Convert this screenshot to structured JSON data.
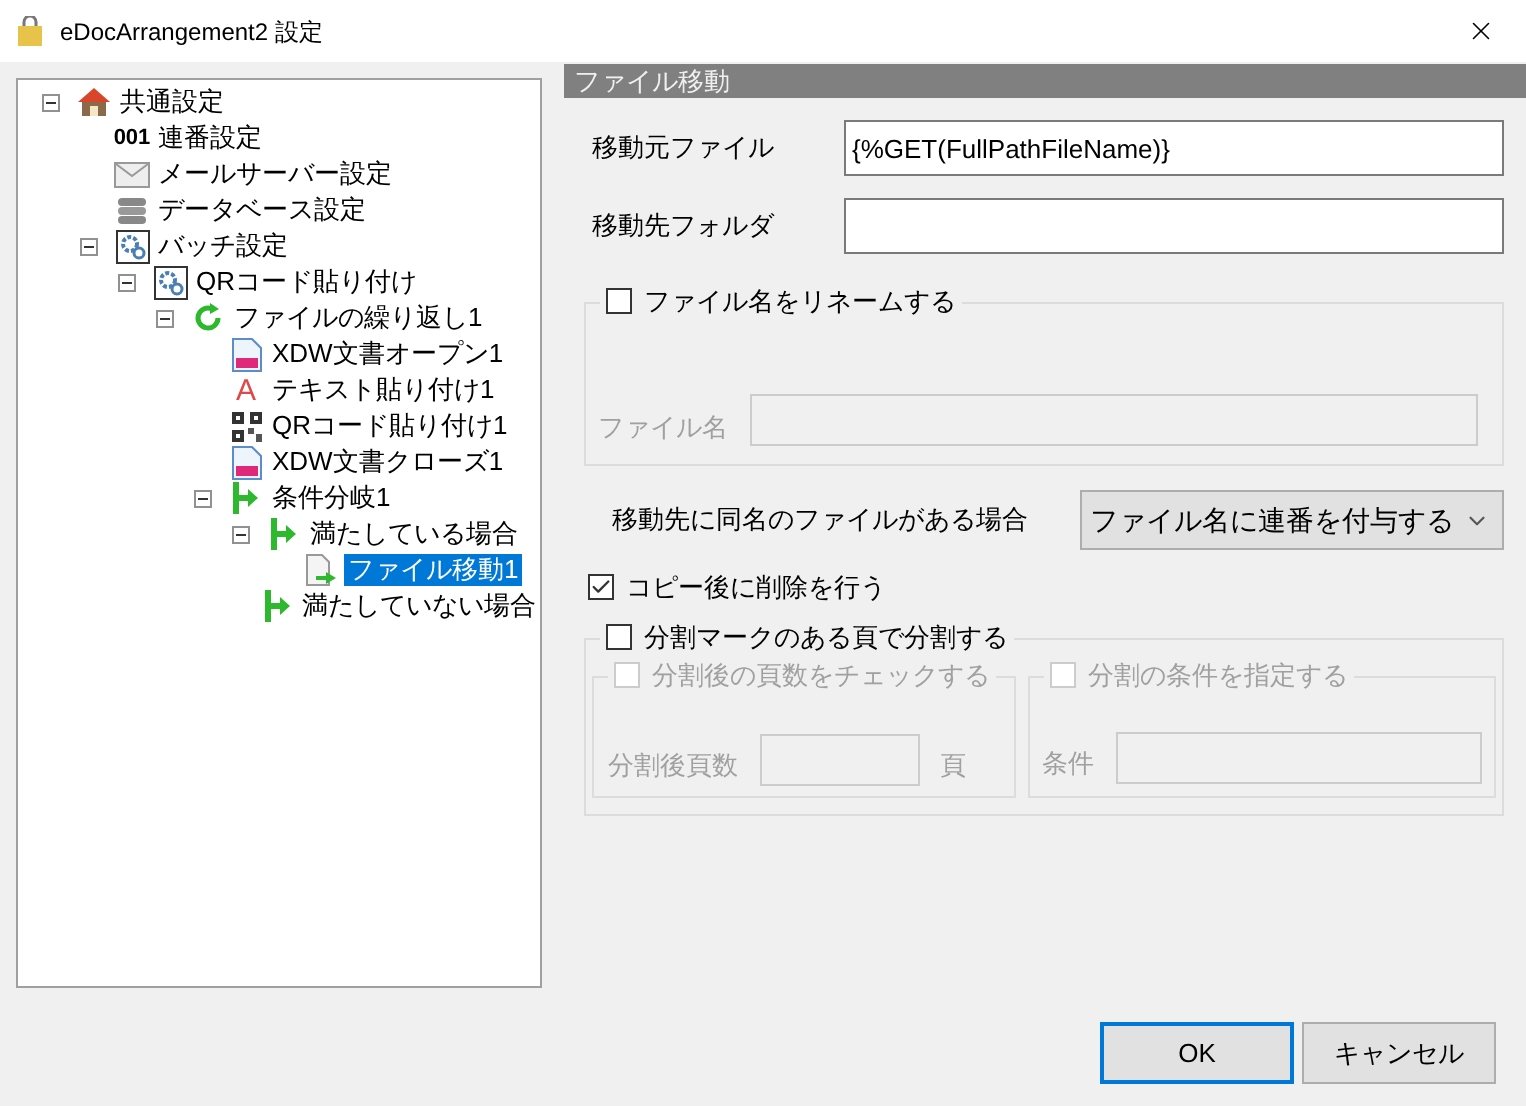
{
  "window": {
    "title": "eDocArrangement2 設定"
  },
  "tree": [
    {
      "label": "共通設定",
      "kind": "house",
      "expanded": true,
      "selected": false,
      "children": [
        {
          "label": "連番設定",
          "kind": "number",
          "badge": "001",
          "selected": false
        },
        {
          "label": "メールサーバー設定",
          "kind": "mail",
          "selected": false
        },
        {
          "label": "データベース設定",
          "kind": "database",
          "selected": false
        },
        {
          "label": "バッチ設定",
          "kind": "gear",
          "expanded": true,
          "selected": false,
          "children": [
            {
              "label": "QRコード貼り付け",
              "kind": "gear",
              "expanded": true,
              "selected": false,
              "children": [
                {
                  "label": "ファイルの繰り返し1",
                  "kind": "loop",
                  "expanded": true,
                  "selected": false,
                  "children": [
                    {
                      "label": "XDW文書オープン1",
                      "kind": "doc",
                      "selected": false
                    },
                    {
                      "label": "テキスト貼り付け1",
                      "kind": "letter",
                      "badge": "A",
                      "selected": false
                    },
                    {
                      "label": "QRコード貼り付け1",
                      "kind": "qr",
                      "selected": false
                    },
                    {
                      "label": "XDW文書クローズ1",
                      "kind": "doc",
                      "selected": false
                    },
                    {
                      "label": "条件分岐1",
                      "kind": "branch",
                      "expanded": true,
                      "selected": false,
                      "children": [
                        {
                          "label": "満たしている場合",
                          "kind": "branch",
                          "expanded": true,
                          "selected": false,
                          "children": [
                            {
                              "label": "ファイル移動1",
                              "kind": "filemove",
                              "selected": true
                            }
                          ]
                        },
                        {
                          "label": "満たしていない場合",
                          "kind": "branch",
                          "selected": false
                        }
                      ]
                    }
                  ]
                }
              ]
            }
          ]
        }
      ]
    }
  ],
  "panel": {
    "title": "ファイル移動",
    "fields": [
      {
        "label": "移動元ファイル",
        "value": "{%GET(FullPathFileName)}"
      },
      {
        "label": "移動先フォルダ"
      }
    ],
    "rename_group": {
      "label": "ファイル名をリネームする",
      "checked": false,
      "field_label": "ファイル名",
      "disabled": true
    },
    "duplicate": {
      "label": "移動先に同名のファイルがある場合",
      "value": "ファイル名に連番を付与する"
    },
    "delete_after_copy": {
      "label": "コピー後に削除を行う",
      "checked": true
    },
    "split_group": {
      "label": "分割マークのある頁で分割する",
      "checked": false,
      "page_check": {
        "label": "分割後の頁数をチェックする",
        "checked": false,
        "disabled": true,
        "field_label": "分割後頁数",
        "unit": "頁"
      },
      "condition": {
        "label": "分割の条件を指定する",
        "checked": false,
        "disabled": true,
        "field_label": "条件"
      }
    }
  },
  "buttons": [
    {
      "label": "OK",
      "kind": "default"
    },
    {
      "label": "キャンセル",
      "kind": "normal"
    }
  ]
}
